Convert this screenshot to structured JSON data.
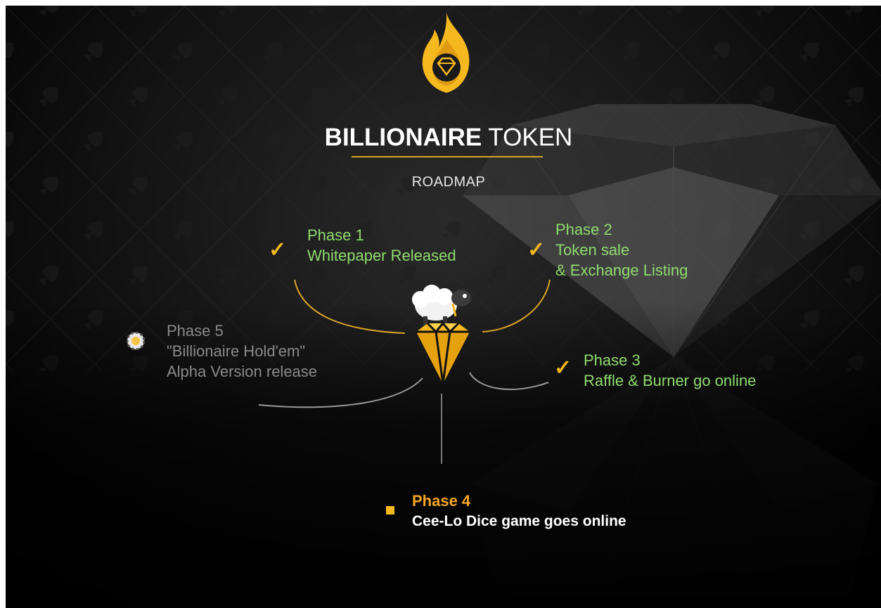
{
  "brand": {
    "bold": "BILLIONAIRE",
    "light": "TOKEN"
  },
  "subtitle": "ROADMAP",
  "phases": [
    {
      "title": "Phase 1",
      "lines": [
        "Whitepaper Released"
      ],
      "status": "done"
    },
    {
      "title": "Phase 2",
      "lines": [
        "Token sale",
        "& Exchange Listing"
      ],
      "status": "done"
    },
    {
      "title": "Phase 3",
      "lines": [
        "Raffle & Burner go online"
      ],
      "status": "done"
    },
    {
      "title": "Phase 4",
      "lines": [
        "Cee-Lo Dice game goes online"
      ],
      "status": "current"
    },
    {
      "title": "Phase 5",
      "lines": [
        "\"Billionaire Hold'em\"",
        "Alpha Version release"
      ],
      "status": "upcoming"
    }
  ],
  "icons": {
    "logo": "flame-diamond-logo-icon",
    "done": "checkmark-icon",
    "current": "square-bullet-icon",
    "upcoming": "poker-chip-icon",
    "mascot": "sheep-on-diamond-icon"
  },
  "colors": {
    "accent": "#f5b81e",
    "done": "#8fdc6f",
    "current_title": "#f5a623",
    "upcoming": "#8a8a8a",
    "background": "#111111"
  }
}
